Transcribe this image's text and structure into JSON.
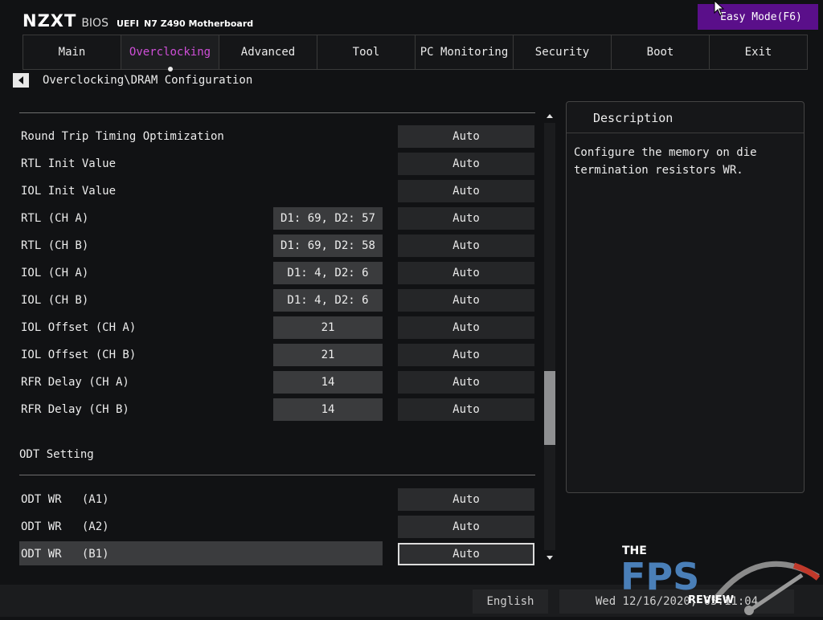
{
  "header": {
    "brand": "NZXT",
    "bios_label": "BIOS",
    "uefi_label": "UEFI",
    "model": "N7 Z490 Motherboard",
    "easy_mode_button": "Easy Mode(F6)"
  },
  "tabs": [
    {
      "label": "Main"
    },
    {
      "label": "Overclocking",
      "active": true
    },
    {
      "label": "Advanced"
    },
    {
      "label": "Tool"
    },
    {
      "label": "PC Monitoring"
    },
    {
      "label": "Security"
    },
    {
      "label": "Boot"
    },
    {
      "label": "Exit"
    }
  ],
  "breadcrumb": "Overclocking\\DRAM Configuration",
  "settings": [
    {
      "label": "Round Trip Timing Optimization",
      "readout": "",
      "value": "Auto"
    },
    {
      "label": "RTL Init Value",
      "readout": "",
      "value": "Auto"
    },
    {
      "label": "IOL Init Value",
      "readout": "",
      "value": "Auto"
    },
    {
      "label": "RTL (CH A)",
      "readout": "D1: 69, D2: 57",
      "value": "Auto"
    },
    {
      "label": "RTL (CH B)",
      "readout": "D1: 69, D2: 58",
      "value": "Auto"
    },
    {
      "label": "IOL (CH A)",
      "readout": "D1: 4, D2: 6",
      "value": "Auto"
    },
    {
      "label": "IOL (CH B)",
      "readout": "D1: 4, D2: 6",
      "value": "Auto"
    },
    {
      "label": "IOL Offset (CH A)",
      "readout": "21",
      "value": "Auto"
    },
    {
      "label": "IOL Offset (CH B)",
      "readout": "21",
      "value": "Auto"
    },
    {
      "label": "RFR Delay (CH A)",
      "readout": "14",
      "value": "Auto"
    },
    {
      "label": "RFR Delay (CH B)",
      "readout": "14",
      "value": "Auto"
    }
  ],
  "odt_section": {
    "title": "ODT Setting",
    "items": [
      {
        "label": "ODT WR   (A1)",
        "value": "Auto"
      },
      {
        "label": "ODT WR   (A2)",
        "value": "Auto"
      },
      {
        "label": "ODT WR   (B1)",
        "value": "Auto",
        "selected": true
      }
    ]
  },
  "description": {
    "title": "Description",
    "text": "Configure the memory on die termination resistors WR."
  },
  "footer": {
    "language": "English",
    "datetime": "Wed 12/16/2020, 05:11:04"
  },
  "watermark": {
    "line1": "THE",
    "line2": "FPS",
    "line3": "REVIEW"
  },
  "colors": {
    "background": "#111214",
    "accent": "#cf4fd8",
    "easy_mode": "#5a0f8a",
    "watermark_blue": "#4a7fb8",
    "watermark_red": "#c0392b"
  },
  "scrollbar": {
    "position_fraction": 0.58
  }
}
